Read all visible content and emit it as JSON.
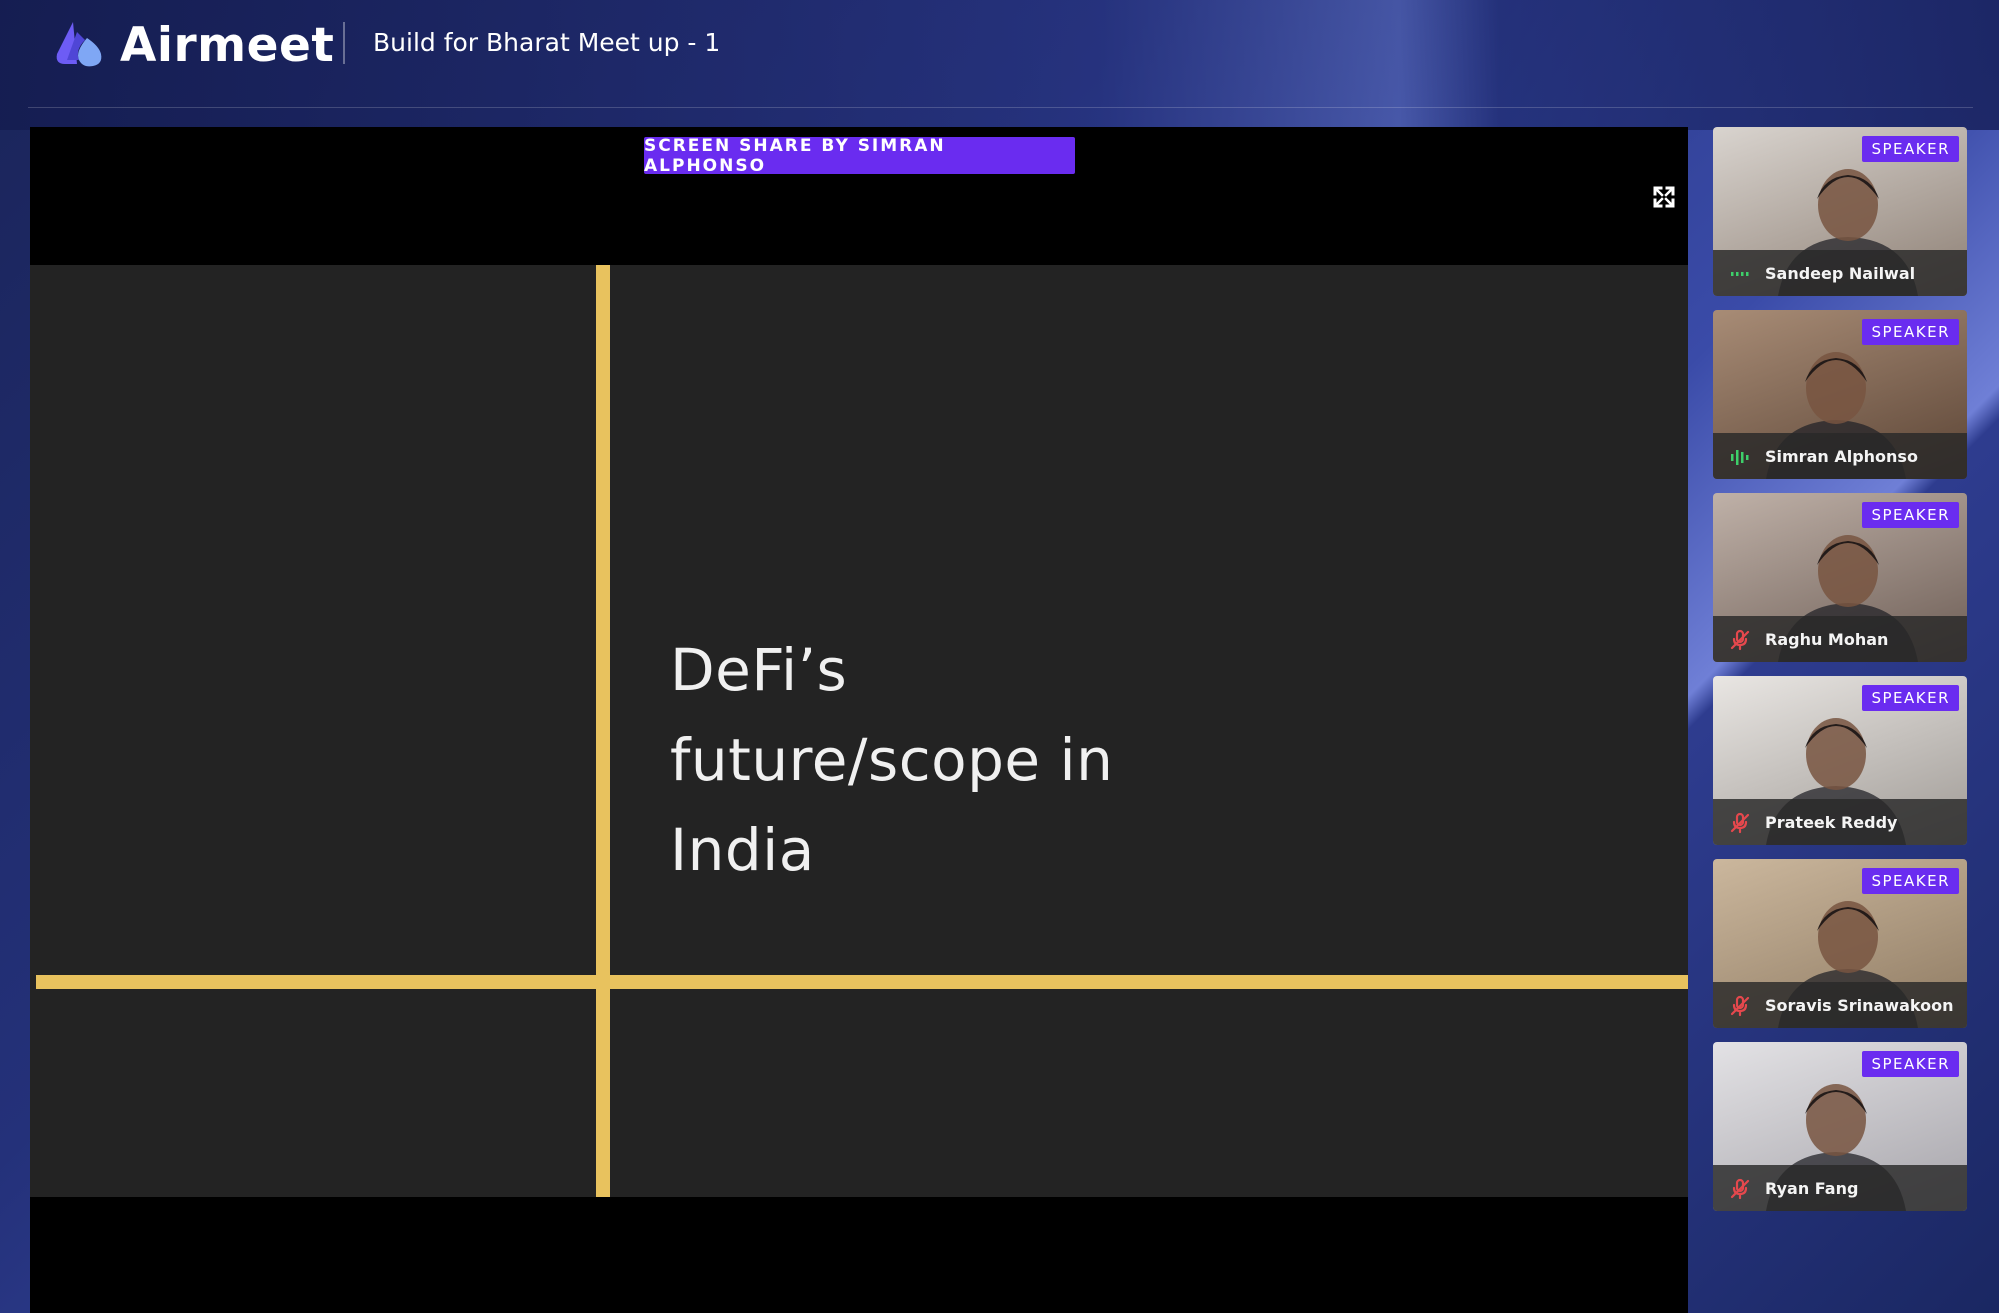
{
  "app": {
    "brand": "Airmeet",
    "event_title": "Build for Bharat Meet up - 1"
  },
  "stage": {
    "share_label": "SCREEN SHARE BY SIMRAN ALPHONSO",
    "slide_lines": [
      "DeFi’s",
      "future/scope in",
      "India"
    ]
  },
  "speakers": [
    {
      "name": "Sandeep Nailwal",
      "badge": "SPEAKER",
      "mic": "active-low",
      "bg": [
        "#d9d4cf",
        "#8d7f74"
      ]
    },
    {
      "name": "Simran Alphonso",
      "badge": "SPEAKER",
      "mic": "speaking",
      "bg": [
        "#a88c76",
        "#5c4536"
      ]
    },
    {
      "name": "Raghu Mohan",
      "badge": "SPEAKER",
      "mic": "muted",
      "bg": [
        "#bfb1a8",
        "#6d5d55"
      ]
    },
    {
      "name": "Prateek Reddy",
      "badge": "SPEAKER",
      "mic": "muted",
      "bg": [
        "#e9e6e3",
        "#9f9a95"
      ]
    },
    {
      "name": "Soravis Srinawakoon",
      "badge": "SPEAKER",
      "mic": "muted",
      "bg": [
        "#cbb79d",
        "#8e7a62"
      ]
    },
    {
      "name": "Ryan Fang",
      "badge": "SPEAKER",
      "mic": "muted",
      "bg": [
        "#e3e2e5",
        "#a6a4aa"
      ]
    }
  ],
  "colors": {
    "accent": "#6a2cf0",
    "slide_line": "#e8c25e",
    "mic_active": "#3ecf6a",
    "mic_muted": "#e5484d"
  }
}
